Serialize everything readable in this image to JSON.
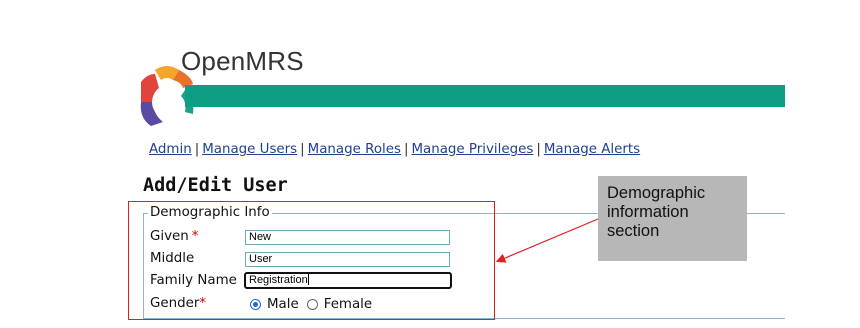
{
  "brand": {
    "name": "OpenMRS",
    "bar_color": "#0f9d84"
  },
  "nav": {
    "items": [
      {
        "label": "Admin"
      },
      {
        "label": "Manage Users"
      },
      {
        "label": "Manage Roles"
      },
      {
        "label": "Manage Privileges"
      },
      {
        "label": "Manage Alerts"
      }
    ],
    "separator": "|"
  },
  "page": {
    "title": "Add/Edit User"
  },
  "demographic": {
    "legend": "Demographic Info",
    "given": {
      "label": "Given",
      "value": "New"
    },
    "middle": {
      "label": "Middle",
      "value": "User"
    },
    "family": {
      "label": "Family Name",
      "value": "Registration"
    },
    "gender": {
      "label": "Gender",
      "options": [
        {
          "label": "Male",
          "selected": true
        },
        {
          "label": "Female",
          "selected": false
        }
      ]
    },
    "required_marker": "*"
  },
  "annotation": {
    "callout": "Demographic information section",
    "highlight_color": "#e02020"
  }
}
